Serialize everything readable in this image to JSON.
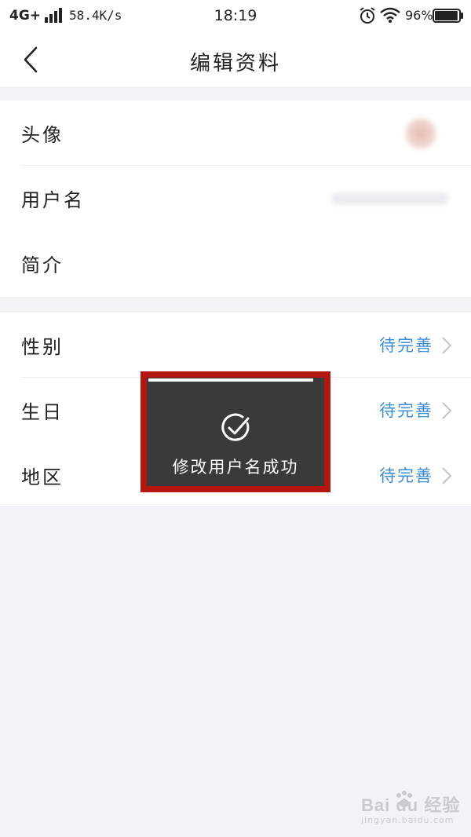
{
  "status_bar": {
    "network": "4G+",
    "speed": "58.4K/s",
    "time": "18:19",
    "battery_percent": "96%",
    "battery_level": 0.96
  },
  "header": {
    "title": "编辑资料"
  },
  "group_profile": {
    "rows": [
      {
        "label": "头像"
      },
      {
        "label": "用户名"
      },
      {
        "label": "简介"
      }
    ]
  },
  "group_details": {
    "rows": [
      {
        "label": "性别",
        "value": "待完善"
      },
      {
        "label": "生日",
        "value": "待完善"
      },
      {
        "label": "地区",
        "value": "待完善"
      }
    ]
  },
  "toast": {
    "message": "修改用户名成功"
  },
  "watermark": {
    "brand": "Bai du 经验",
    "domain": "jingyan.baidu.com"
  },
  "colors": {
    "accent_value": "#3c8dd8",
    "toast_bg": "#3a3a3a",
    "highlight_frame": "#b3160f",
    "page_bg": "#f3f3f7"
  }
}
